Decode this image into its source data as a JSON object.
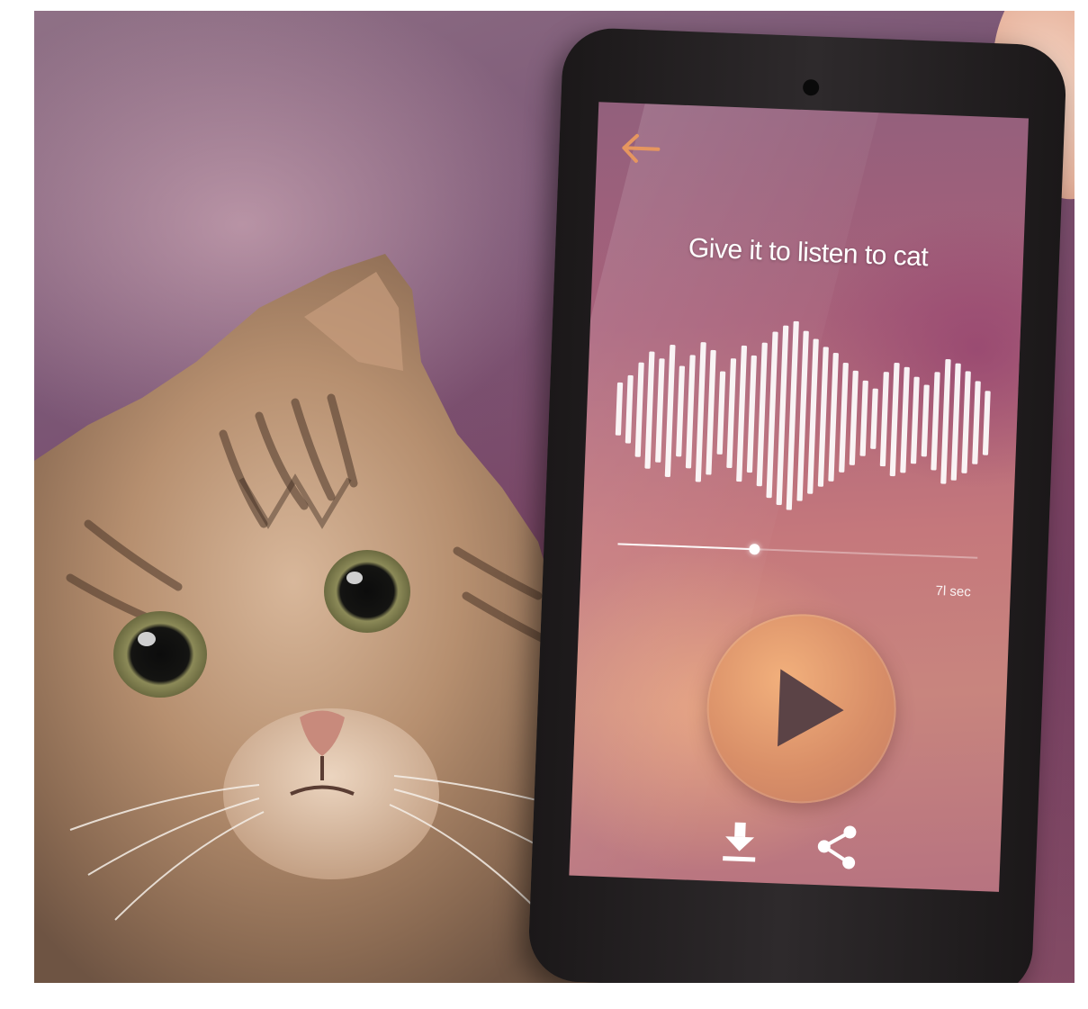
{
  "screen": {
    "title": "Give it to listen to cat",
    "time_label": "7l sec"
  },
  "player": {
    "progress": 0.38
  },
  "icons": {
    "back": "arrow-left-icon",
    "play": "play-icon",
    "download": "download-icon",
    "share": "share-icon"
  },
  "colors": {
    "accent": "#e6965f",
    "play_button": "#d98f68",
    "play_icon": "#5b4346",
    "waveform": "#ffffff"
  },
  "waveform": {
    "bar_levels": [
      0.28,
      0.36,
      0.5,
      0.62,
      0.55,
      0.7,
      0.48,
      0.6,
      0.74,
      0.66,
      0.44,
      0.58,
      0.72,
      0.62,
      0.76,
      0.88,
      0.95,
      1.0,
      0.9,
      0.82,
      0.74,
      0.68,
      0.58,
      0.5,
      0.4,
      0.32,
      0.5,
      0.6,
      0.56,
      0.46,
      0.38,
      0.52,
      0.66,
      0.62,
      0.54,
      0.44,
      0.34
    ]
  }
}
